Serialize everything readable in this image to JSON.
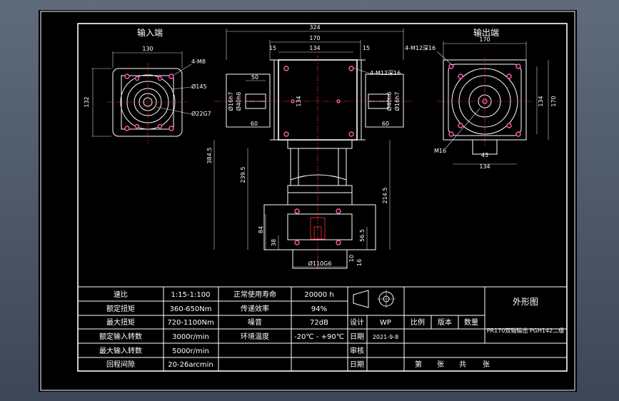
{
  "views": {
    "input_title": "输入端",
    "output_title": "输出端"
  },
  "dims": {
    "in_130": "130",
    "in_4m8": "4-M8",
    "in_145": "Ø145",
    "in_22": "Ø22G7",
    "in_132": "132",
    "top_324": "324",
    "top_170": "170",
    "top_134": "134",
    "top_15a": "15",
    "top_15b": "15",
    "m12_front": "4-M12深16",
    "m12_right": "4-M12深16",
    "d50": "50",
    "d60a": "60",
    "d60b": "60",
    "d134v": "134",
    "d16h7a": "Ø16h7",
    "d16h7b": "Ø16h7",
    "d40a": "Ø40h6",
    "d40b": "Ø40h6",
    "d384": "384.5",
    "d239": "239.5",
    "d214": "214.5",
    "d84": "84",
    "d38": "38",
    "d56": "56.5",
    "d110": "Ø110G6",
    "d10": "10",
    "d16": "16",
    "r_170": "170",
    "r_134v": "134",
    "r_170v": "170",
    "r_43": "43",
    "r_134h": "134",
    "r_m16": "M16"
  },
  "specs": [
    {
      "label": "速比",
      "value": "1:15-1:100",
      "label2": "正常使用寿命",
      "value2": "20000 h"
    },
    {
      "label": "额定扭矩",
      "value": "360-650Nm",
      "label2": "传递效率",
      "value2": "94%"
    },
    {
      "label": "最大扭矩",
      "value": "720-1100Nm",
      "label2": "噪音",
      "value2": "72dB"
    },
    {
      "label": "额定输入转数",
      "value": "3000r/min",
      "label2": "环境温度",
      "value2": "-20℃ - +90℃"
    },
    {
      "label": "最大输入转数",
      "value": "5000r/min",
      "label2": "",
      "value2": ""
    },
    {
      "label": "回程间隙",
      "value": "20-26arcmin",
      "label2": "",
      "value2": ""
    }
  ],
  "title_block": {
    "drawing_name": "外形图",
    "design_label": "设计",
    "design_value": "WP",
    "scale_label": "比例",
    "version_label": "版本",
    "qty_label": "数量",
    "model": "PR170双轴输出 PGH142二级",
    "date_label": "日期",
    "date_value": "2021-9-8",
    "review_label": "审核",
    "date2_label": "日期",
    "page_no": "第",
    "page_sheet": "张",
    "page_total": "共",
    "page_sheet2": "张"
  }
}
